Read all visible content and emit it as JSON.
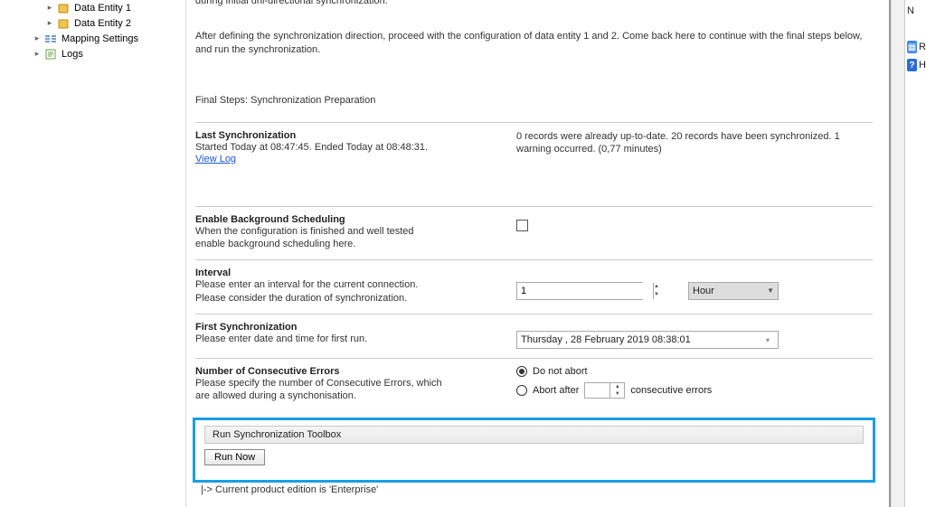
{
  "tree": {
    "items": [
      {
        "label": "Data Entity 1",
        "indent": 1,
        "icon": "db"
      },
      {
        "label": "Data Entity 2",
        "indent": 1,
        "icon": "db"
      },
      {
        "label": "Mapping Settings",
        "indent": 0,
        "icon": "map"
      },
      {
        "label": "Logs",
        "indent": 0,
        "icon": "logs"
      }
    ]
  },
  "intro": {
    "partial_top": "during initial uni-directional synchronization.",
    "after_define": "After defining the synchronization direction, proceed with the configuration of data entity 1 and 2. Come back here to continue with the final steps below, and run the synchronization.",
    "final_steps": "Final Steps: Synchronization Preparation"
  },
  "last_sync": {
    "label": "Last Synchronization",
    "desc": "Started  Today at 08:47:45. Ended Today at 08:48:31.",
    "link": "View Log",
    "summary": "0 records were already up-to-date. 20 records have been synchronized. 1 warning occurred. (0,77 minutes)"
  },
  "bg_sched": {
    "label": "Enable Background Scheduling",
    "desc1": "When the configuration is finished and well tested",
    "desc2": "enable background scheduling here."
  },
  "interval": {
    "label": "Interval",
    "desc1": "Please enter an interval for the current connection.",
    "desc2": "Please consider the duration of synchronization.",
    "value": "1",
    "unit": "Hour"
  },
  "first_sync": {
    "label": "First Synchronization",
    "desc": "Please enter date and time for first run.",
    "value": "Thursday  , 28   February   2019 08:38:01"
  },
  "consec": {
    "label": "Number of Consecutive Errors",
    "desc1": "Please specify the number of Consecutive Errors, which",
    "desc2": "are allowed during a synchonisation.",
    "opt1": "Do not abort",
    "opt2a": "Abort after",
    "opt2b": "consecutive errors"
  },
  "runbox": {
    "title": "Run Synchronization Toolbox",
    "button": "Run Now"
  },
  "status": "|-> Current product edition is 'Enterprise'",
  "rightside": {
    "n": "N",
    "r": "R",
    "h": "H"
  }
}
